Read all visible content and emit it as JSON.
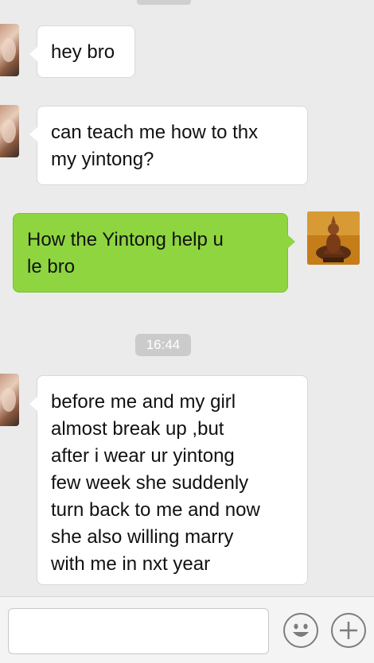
{
  "chat": {
    "messages": [
      {
        "side": "left",
        "text": "hey bro"
      },
      {
        "side": "left",
        "text": "can teach me how to thx\nmy yintong?"
      },
      {
        "side": "right",
        "text": "How the Yintong help u\nle bro"
      },
      {
        "side": "left",
        "text": "before me and my girl\nalmost break up ,but\nafter i wear ur yintong\nfew week she suddenly\nturn back to me and now\nshe also willing marry\nwith me in nxt year"
      }
    ],
    "timestamp": "16:44"
  },
  "input_bar": {
    "message_value": "",
    "emoji_icon": "smiley-icon",
    "attach_icon": "plus-icon"
  },
  "colors": {
    "background": "#ebebeb",
    "sent_bubble": "#8ed540",
    "received_bubble": "#ffffff",
    "timestamp_badge": "#cbcbcb"
  }
}
